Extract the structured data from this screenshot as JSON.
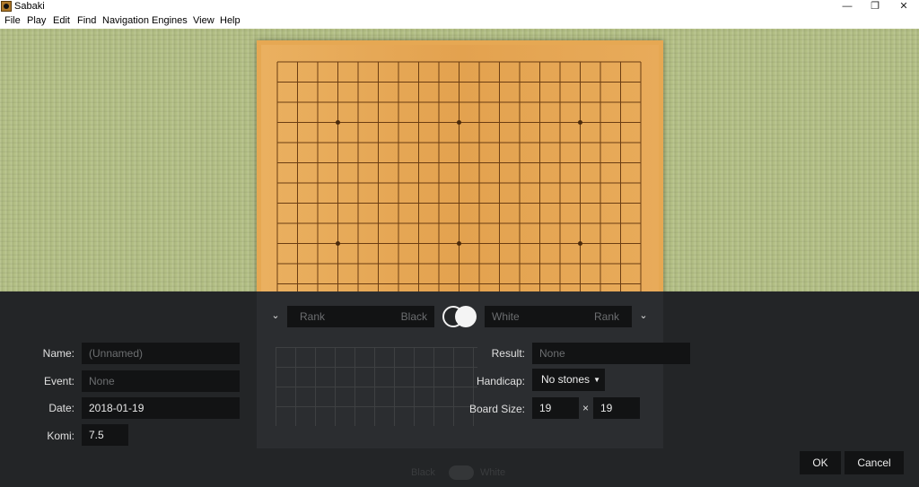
{
  "window": {
    "title": "Sabaki",
    "minimize_glyph": "—",
    "maximize_glyph": "❐",
    "close_glyph": "✕"
  },
  "menu": [
    "File",
    "Play",
    "Edit",
    "Find",
    "Navigation",
    "Engines",
    "View",
    "Help"
  ],
  "board": {
    "size": 19,
    "star_points_shown": 6
  },
  "players": {
    "black": {
      "rank_placeholder": "Rank",
      "name_placeholder": "Black"
    },
    "white": {
      "name_placeholder": "White",
      "rank_placeholder": "Rank"
    }
  },
  "game_info": {
    "name": {
      "label": "Name:",
      "placeholder": "(Unnamed)",
      "value": ""
    },
    "event": {
      "label": "Event:",
      "placeholder": "None",
      "value": ""
    },
    "date": {
      "label": "Date:",
      "value": "2018-01-19"
    },
    "komi": {
      "label": "Komi:",
      "value": "7.5"
    },
    "result": {
      "label": "Result:",
      "placeholder": "None",
      "value": ""
    },
    "handicap": {
      "label": "Handicap:",
      "value": "No stones"
    },
    "board_size": {
      "label": "Board Size:",
      "width": "19",
      "height": "19",
      "separator": "×"
    }
  },
  "buttons": {
    "ok": "OK",
    "cancel": "Cancel"
  },
  "background_hint": {
    "left": "Black",
    "right": "White"
  }
}
